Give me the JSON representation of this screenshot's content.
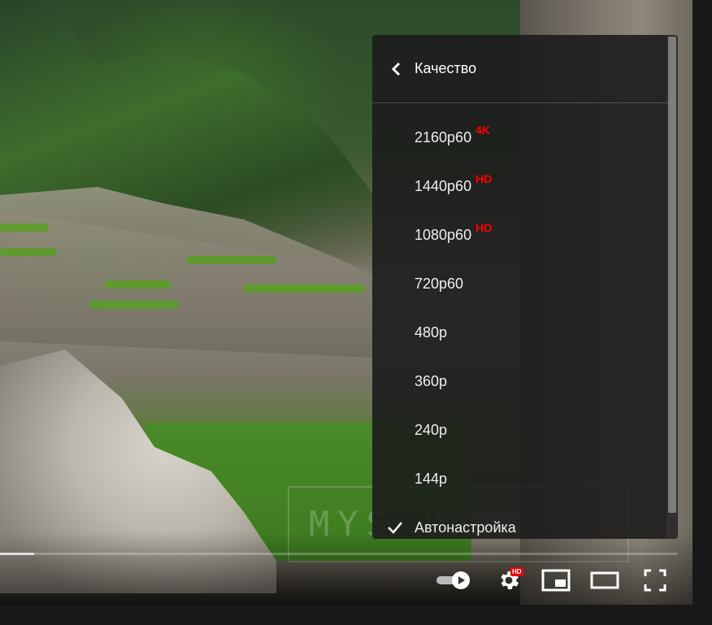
{
  "settings_menu": {
    "title": "Качество",
    "options": [
      {
        "label": "2160p60",
        "badge": "4K"
      },
      {
        "label": "1440p60",
        "badge": "HD"
      },
      {
        "label": "1080p60",
        "badge": "HD"
      },
      {
        "label": "720p60",
        "badge": ""
      },
      {
        "label": "480p",
        "badge": ""
      },
      {
        "label": "360p",
        "badge": ""
      },
      {
        "label": "240p",
        "badge": ""
      },
      {
        "label": "144p",
        "badge": ""
      },
      {
        "label": "Автонастройка",
        "badge": "",
        "selected": true
      }
    ]
  },
  "player": {
    "watermark": "MYS  OX",
    "progress_fraction": 0.05,
    "settings_badge": "HD",
    "accent_color": "#ff0000"
  }
}
